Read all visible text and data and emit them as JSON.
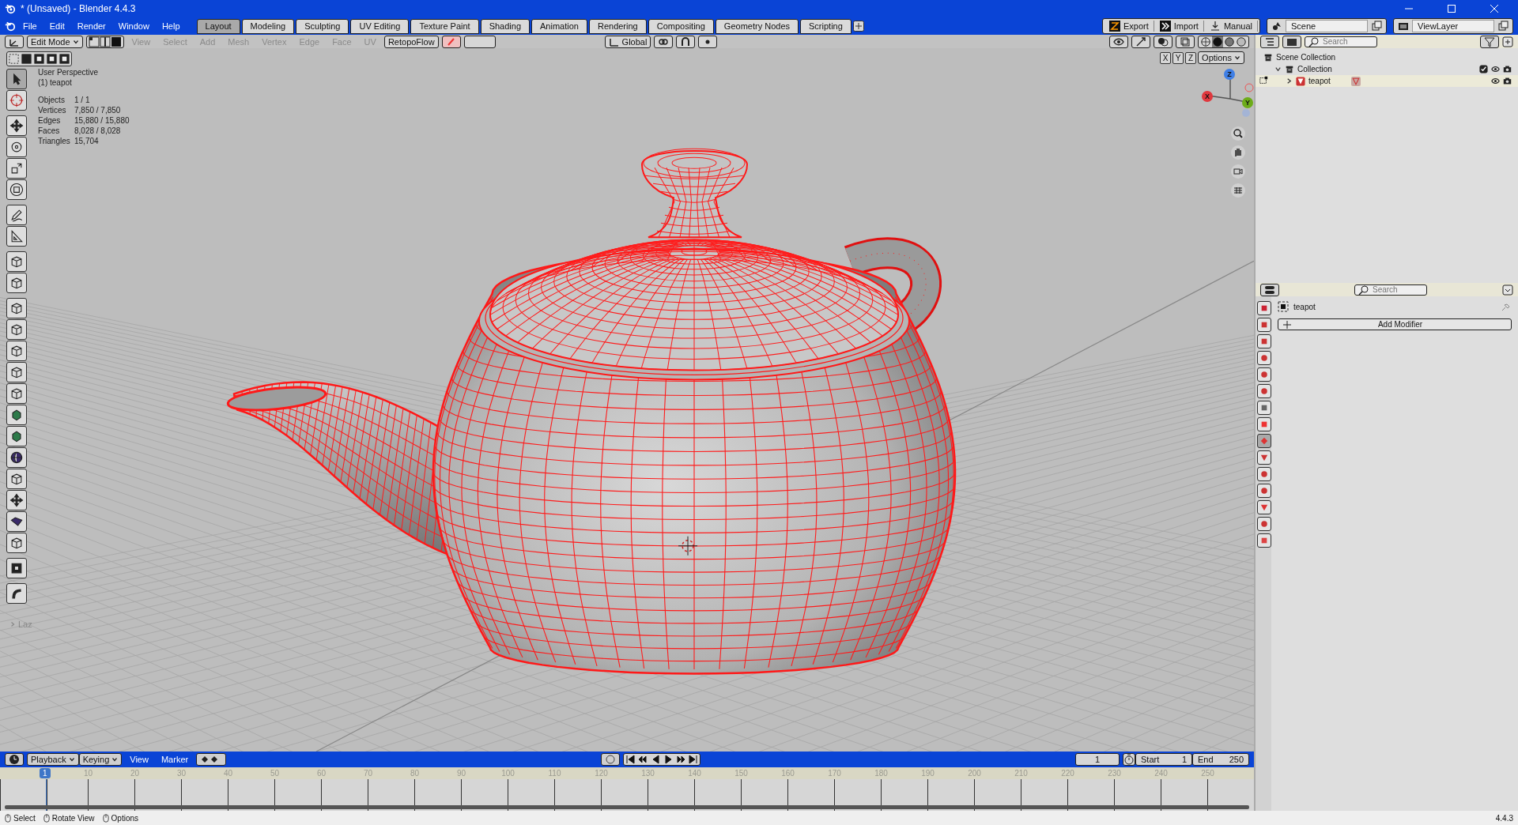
{
  "window": {
    "title": "* (Unsaved) - Blender 4.4.3"
  },
  "menu": [
    "File",
    "Edit",
    "Render",
    "Window",
    "Help"
  ],
  "workspaces": [
    {
      "label": "Layout",
      "selected": true
    },
    {
      "label": "Modeling",
      "selected": false
    },
    {
      "label": "Sculpting",
      "selected": false
    },
    {
      "label": "UV Editing",
      "selected": false
    },
    {
      "label": "Texture Paint",
      "selected": false
    },
    {
      "label": "Shading",
      "selected": false
    },
    {
      "label": "Animation",
      "selected": false
    },
    {
      "label": "Rendering",
      "selected": false
    },
    {
      "label": "Compositing",
      "selected": false
    },
    {
      "label": "Geometry Nodes",
      "selected": false
    },
    {
      "label": "Scripting",
      "selected": false
    }
  ],
  "top_buttons": [
    "Export",
    "Import",
    "Manual"
  ],
  "scene": "Scene",
  "view_layer": "ViewLayer",
  "viewport": {
    "mode": "Edit Mode",
    "menus": [
      {
        "label": "View",
        "disabled": true
      },
      {
        "label": "Select",
        "disabled": true
      },
      {
        "label": "Add",
        "disabled": true
      },
      {
        "label": "Mesh",
        "disabled": true
      },
      {
        "label": "Vertex",
        "disabled": true
      },
      {
        "label": "Edge",
        "disabled": true
      },
      {
        "label": "Face",
        "disabled": true
      },
      {
        "label": "UV",
        "disabled": true
      }
    ],
    "addon_menu": "RetopoFlow",
    "orientation": "Global",
    "options": "Options",
    "mirror_axes": [
      "X",
      "Y",
      "Z"
    ],
    "shading_modes": [
      {
        "selected": false
      },
      {
        "selected": true
      },
      {
        "selected": false
      },
      {
        "selected": false
      }
    ],
    "view_name": "User Perspective",
    "object_label": "(1) teapot",
    "stats": [
      {
        "label": "Objects",
        "value": "1 / 1"
      },
      {
        "label": "Vertices",
        "value": "7,850 / 7,850"
      },
      {
        "label": "Edges",
        "value": "15,880 / 15,880"
      },
      {
        "label": "Faces",
        "value": "8,028 / 8,028"
      },
      {
        "label": "Triangles",
        "value": "15,704"
      }
    ],
    "last_operator": "Laz",
    "gizmo_axes": [
      "X",
      "Y",
      "Z"
    ],
    "tool_groups": [
      [
        {
          "kind": "pointer",
          "selected": true
        },
        {
          "kind": "crosshair",
          "selected": false
        }
      ],
      [
        {
          "kind": "move",
          "selected": false
        },
        {
          "kind": "rotate",
          "selected": false
        },
        {
          "kind": "scale",
          "selected": false
        },
        {
          "kind": "transform",
          "selected": false
        }
      ],
      [
        {
          "kind": "pencil",
          "selected": false
        },
        {
          "kind": "ruler",
          "selected": false
        }
      ],
      [
        {
          "kind": "cube",
          "selected": false
        },
        {
          "kind": "cube",
          "selected": false
        }
      ],
      [
        {
          "kind": "cube",
          "selected": false
        },
        {
          "kind": "cube",
          "selected": false
        },
        {
          "kind": "cube",
          "selected": false
        },
        {
          "kind": "cube",
          "selected": false
        },
        {
          "kind": "cube",
          "selected": false
        },
        {
          "kind": "blob",
          "selected": false
        },
        {
          "kind": "blob",
          "selected": false
        },
        {
          "kind": "sphere",
          "selected": false
        },
        {
          "kind": "cube",
          "selected": false
        },
        {
          "kind": "move",
          "selected": false
        },
        {
          "kind": "wedge",
          "selected": false
        },
        {
          "kind": "cube",
          "selected": false
        }
      ],
      [
        {
          "kind": "square",
          "selected": false
        }
      ],
      [
        {
          "kind": "curve",
          "selected": false
        }
      ]
    ]
  },
  "outliner": {
    "search": {
      "placeholder": "Search"
    },
    "tree": [
      {
        "label": "Scene Collection",
        "children": [
          {
            "label": "Collection",
            "expanded": true,
            "enabled": true,
            "children": [
              {
                "label": "teapot",
                "expanded": false,
                "selected": true
              }
            ]
          }
        ]
      }
    ]
  },
  "properties": {
    "search": {
      "placeholder": "Search"
    },
    "object": "teapot",
    "add_button": "Add Modifier",
    "tabs": [
      {
        "kind": "tool",
        "selected": false
      },
      {
        "kind": "render",
        "selected": false
      },
      {
        "kind": "output",
        "selected": false
      },
      {
        "kind": "view",
        "selected": false
      },
      {
        "kind": "scene",
        "selected": false
      },
      {
        "kind": "world",
        "selected": false
      },
      {
        "kind": "collection",
        "selected": false
      },
      {
        "kind": "object",
        "selected": false
      },
      {
        "kind": "modifier",
        "selected": true
      },
      {
        "kind": "particles",
        "selected": false
      },
      {
        "kind": "physics",
        "selected": false
      },
      {
        "kind": "constraints",
        "selected": false
      },
      {
        "kind": "data",
        "selected": false
      },
      {
        "kind": "material",
        "selected": false
      },
      {
        "kind": "texture",
        "selected": false
      }
    ]
  },
  "timeline": {
    "auto_key": {
      "on": false
    },
    "menus": [
      "Playback",
      "Keying"
    ],
    "plain_menus": [
      "View",
      "Marker"
    ],
    "current_frame": "1",
    "start_label": "Start",
    "start": "1",
    "end_label": "End",
    "end": "250",
    "ruler": [
      "10",
      "20",
      "30",
      "40",
      "50",
      "60",
      "70",
      "80",
      "90",
      "100",
      "110",
      "120",
      "130",
      "140",
      "150",
      "160",
      "170",
      "180",
      "190",
      "200",
      "210",
      "220",
      "230",
      "240",
      "250"
    ],
    "playhead": "1"
  },
  "status_bar": {
    "hints": [
      "Select",
      "Rotate View",
      "Options"
    ],
    "version": "4.4.3"
  }
}
